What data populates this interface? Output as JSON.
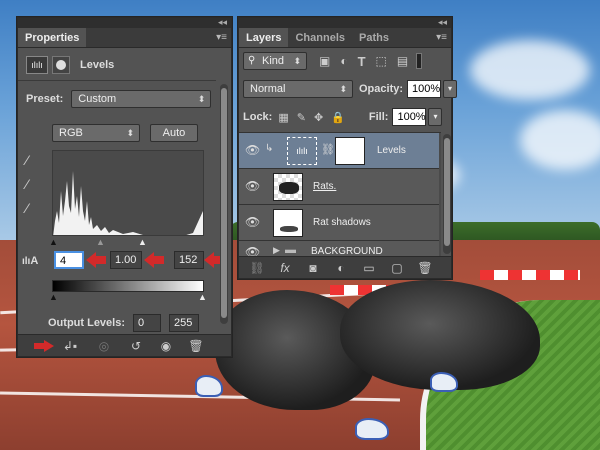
{
  "properties_panel": {
    "tab": "Properties",
    "header_title": "Levels",
    "preset_label": "Preset:",
    "preset_value": "Custom",
    "channel_value": "RGB",
    "auto_label": "Auto",
    "input_black": "4",
    "input_gamma": "1.00",
    "input_white": "152",
    "output_label": "Output Levels:",
    "output_black": "0",
    "output_white": "255"
  },
  "layers_panel": {
    "tabs": [
      "Layers",
      "Channels",
      "Paths"
    ],
    "filter_label": "Kind",
    "blend_mode": "Normal",
    "opacity_label": "Opacity:",
    "opacity_value": "100%",
    "lock_label": "Lock:",
    "fill_label": "Fill:",
    "fill_value": "100%",
    "layers": [
      {
        "name": "Levels"
      },
      {
        "name": "Rats."
      },
      {
        "name": "Rat shadows"
      },
      {
        "name": "BACKGROUND"
      }
    ]
  },
  "icons": [
    "collapse-icon",
    "panel-menu-icon",
    "levels-adjustment-icon",
    "mask-icon",
    "eyedropper-icon",
    "eye-icon",
    "folder-icon",
    "link-icon",
    "fx-icon",
    "trash-icon",
    "reset-icon",
    "clip-icon"
  ],
  "colors": {
    "panel": "#535353",
    "selected_layer": "#6d7f95",
    "accent_arrow": "#d32a2a"
  }
}
